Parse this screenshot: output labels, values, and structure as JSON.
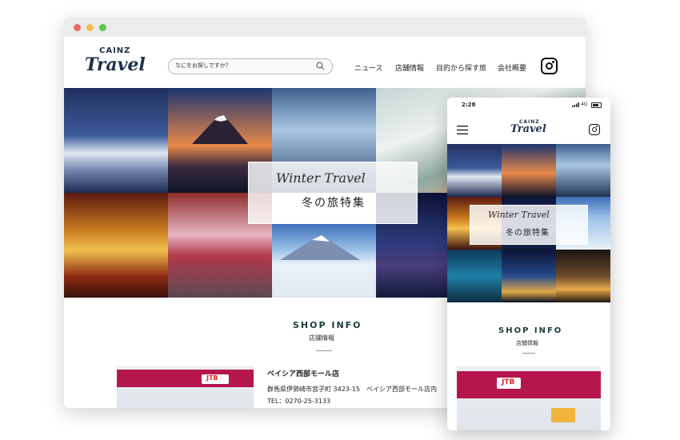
{
  "desktop": {
    "logo": {
      "top": "CAINZ",
      "script": "Travel"
    },
    "search": {
      "placeholder": "なにをお探しですか？"
    },
    "nav": [
      "ニュース",
      "店舗情報",
      "目的から探す旅",
      "会社概要"
    ],
    "banner": {
      "script": "Winter Travel",
      "title": "冬の旅特集"
    },
    "shop": {
      "heading": "SHOP INFO",
      "subheading": "店舗情報",
      "store_name": "ベイシア西部モール店",
      "address": "群馬県伊勢崎市宮子町 3423-15　ベイシア西部モール店内",
      "tel": "TEL：0270-25-3133",
      "sign": "JTB"
    }
  },
  "mobile": {
    "time": "2:28",
    "network": "4G",
    "logo": {
      "top": "CAINZ",
      "script": "Travel"
    },
    "banner": {
      "script": "Winter Travel",
      "title": "冬の旅特集"
    },
    "shop": {
      "heading": "SHOP INFO",
      "subheading": "店舗情報",
      "sign": "JTB"
    }
  },
  "colors": {
    "brand_navy": "#1f2f4d",
    "heading_green": "#1d3b3a",
    "sign_red": "#b5174d",
    "chrome_red": "#ed6a5e",
    "chrome_yellow": "#f5bf4f",
    "chrome_green": "#62c554"
  },
  "icons": [
    "instagram-icon",
    "search-icon",
    "hamburger-menu-icon",
    "signal-icon",
    "battery-icon"
  ]
}
